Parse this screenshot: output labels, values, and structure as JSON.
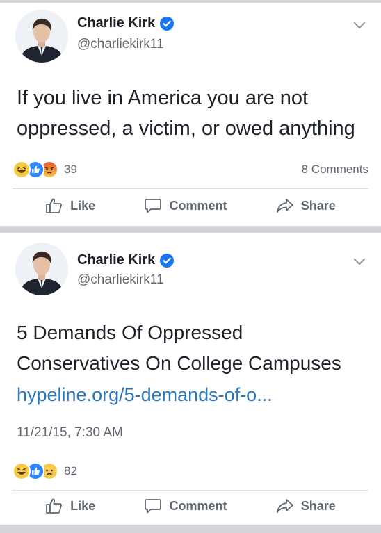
{
  "posts": [
    {
      "author_name": "Charlie Kirk",
      "handle": "@charliekirk11",
      "text": "If you live in America you are not\noppressed, a victim, or owed anything",
      "reaction_count": "39",
      "reactions": [
        "haha-icon",
        "like-icon",
        "angry-icon"
      ],
      "comments": "8 Comments",
      "actions": {
        "like": "Like",
        "comment": "Comment",
        "share": "Share"
      }
    },
    {
      "author_name": "Charlie Kirk",
      "handle": "@charliekirk11",
      "text": "5 Demands Of Oppressed\nConservatives On College Campuses",
      "link": "hypeline.org/5-demands-of-o...",
      "timestamp": "11/21/15, 7:30 AM",
      "reaction_count": "82",
      "reactions": [
        "haha-icon",
        "like-icon",
        "sad-icon"
      ],
      "actions": {
        "like": "Like",
        "comment": "Comment",
        "share": "Share"
      }
    }
  ],
  "colors": {
    "verified_blue": "#1877f2",
    "link_blue": "#2b76b9",
    "like_blue": "#2d88ff",
    "emoji_yellow": "#f7c948",
    "angry_red": "#e9542f"
  }
}
